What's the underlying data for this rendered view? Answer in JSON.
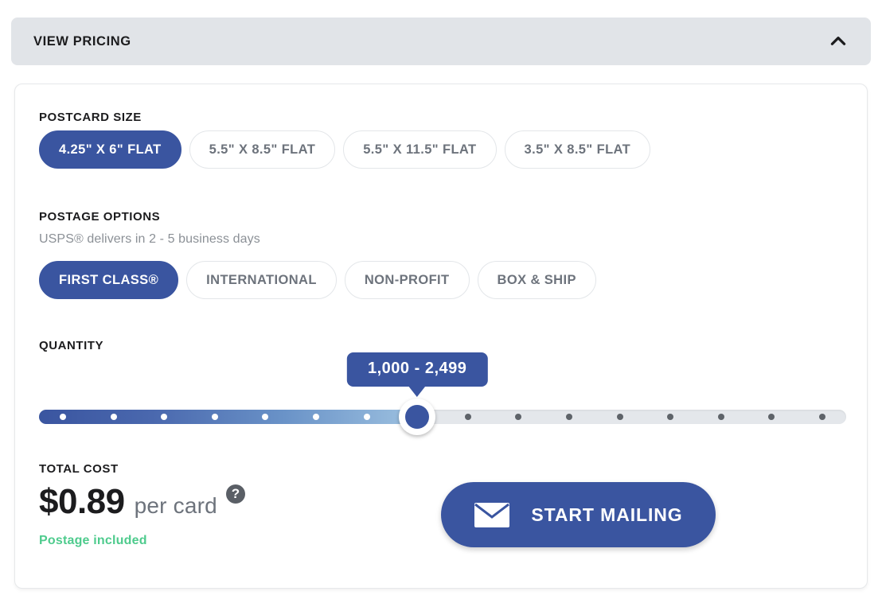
{
  "header": {
    "title": "VIEW PRICING",
    "toggle_icon": "chevron-up-icon"
  },
  "postcard_size": {
    "label": "POSTCARD SIZE",
    "options": [
      {
        "label": "4.25\" X 6\" FLAT",
        "selected": true
      },
      {
        "label": "5.5\" X 8.5\" FLAT",
        "selected": false
      },
      {
        "label": "5.5\" X 11.5\" FLAT",
        "selected": false
      },
      {
        "label": "3.5\" X 8.5\" FLAT",
        "selected": false
      }
    ]
  },
  "postage_options": {
    "label": "POSTAGE OPTIONS",
    "delivery_note": "USPS® delivers in 2 - 5 business days",
    "options": [
      {
        "label": "FIRST CLASS®",
        "selected": true
      },
      {
        "label": "INTERNATIONAL",
        "selected": false
      },
      {
        "label": "NON-PROFIT",
        "selected": false
      },
      {
        "label": "BOX & SHIP",
        "selected": false
      }
    ]
  },
  "quantity": {
    "label": "QUANTITY",
    "tooltip_value": "1,000 - 2,499",
    "steps": 16,
    "selected_index": 7
  },
  "total_cost": {
    "label": "TOTAL COST",
    "amount": "$0.89",
    "unit": "per card",
    "help_icon": "question-mark-icon",
    "note": "Postage included"
  },
  "cta": {
    "label": "START MAILING",
    "icon": "envelope-icon"
  },
  "colors": {
    "brand_blue": "#3a55a0",
    "header_bg": "#e1e4e8",
    "track_bg": "#e4e7eb",
    "success_green": "#4ecb8d",
    "muted_text": "#6d737c"
  }
}
